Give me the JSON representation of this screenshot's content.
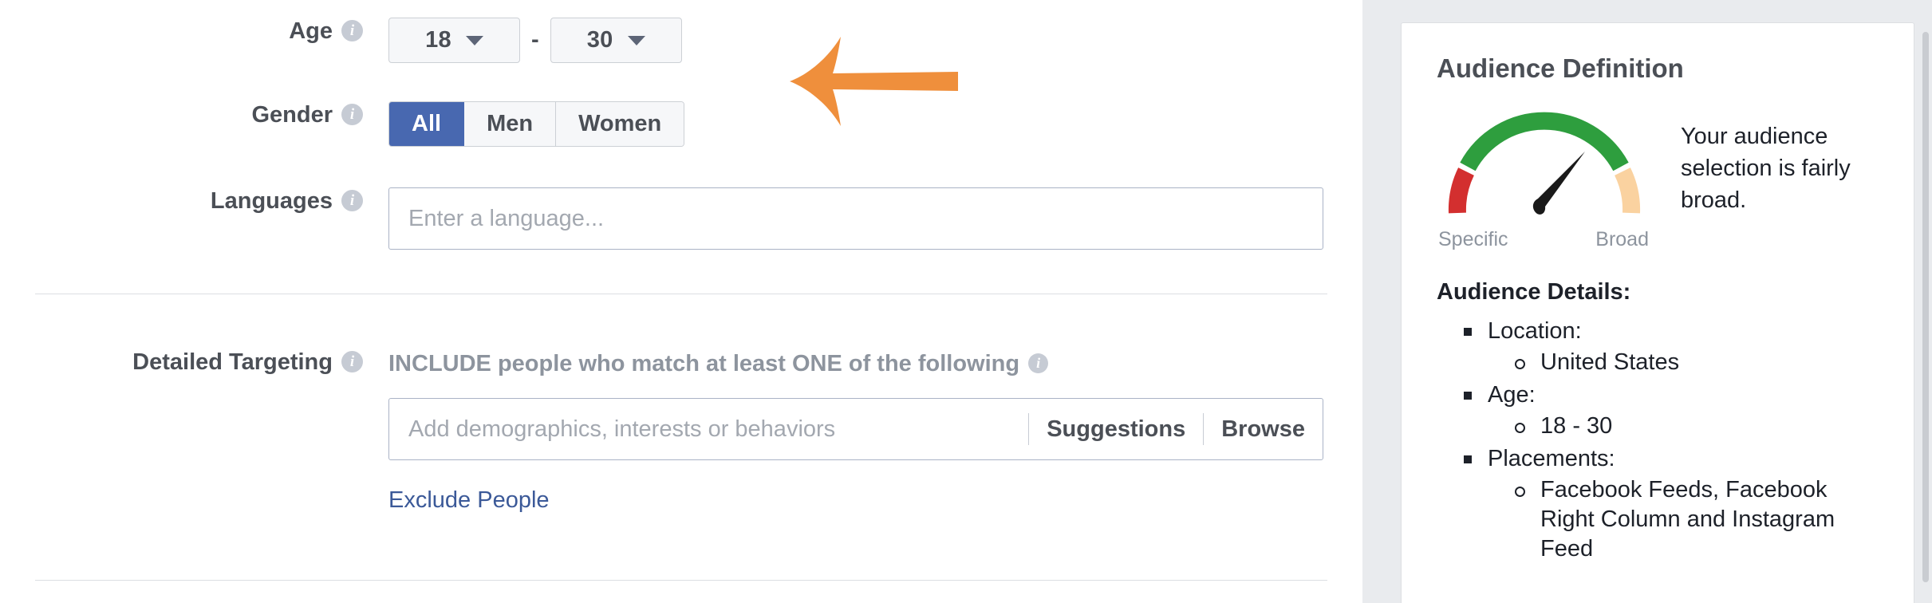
{
  "form": {
    "age": {
      "label": "Age",
      "info_icon": "info-icon",
      "min_value": "18",
      "max_value": "30",
      "separator": "-"
    },
    "gender": {
      "label": "Gender",
      "info_icon": "info-icon",
      "options": [
        "All",
        "Men",
        "Women"
      ],
      "selected": "All",
      "active_color": "#4868b0"
    },
    "languages": {
      "label": "Languages",
      "info_icon": "info-icon",
      "value": "",
      "placeholder": "Enter a language..."
    },
    "detailed_targeting": {
      "label": "Detailed Targeting",
      "info_icon": "info-icon",
      "heading": "INCLUDE people who match at least ONE of the following",
      "heading_info_icon": "info-icon",
      "value": "",
      "placeholder": "Add demographics, interests or behaviors",
      "suggestions_label": "Suggestions",
      "browse_label": "Browse",
      "exclude_label": "Exclude People",
      "link_color": "#3b5998"
    }
  },
  "annotation": {
    "arrow_icon": "left-arrow-icon",
    "color": "#ef8f3c",
    "direction": "left"
  },
  "audience_panel": {
    "title": "Audience Definition",
    "gauge": {
      "left_label": "Specific",
      "right_label": "Broad",
      "needle_position": "fairly-broad",
      "segments": [
        {
          "name": "specific",
          "color": "#d32f2f"
        },
        {
          "name": "balanced",
          "color": "#2e9e3e"
        },
        {
          "name": "broad",
          "color": "#fad2a0"
        }
      ]
    },
    "message": "Your audience selection is fairly broad.",
    "details_title": "Audience Details:",
    "details": [
      {
        "label": "Location:",
        "values": [
          "United States"
        ]
      },
      {
        "label": "Age:",
        "values": [
          "18 - 30"
        ]
      },
      {
        "label": "Placements:",
        "values": [
          "Facebook Feeds, Facebook Right Column and Instagram Feed"
        ]
      }
    ]
  }
}
